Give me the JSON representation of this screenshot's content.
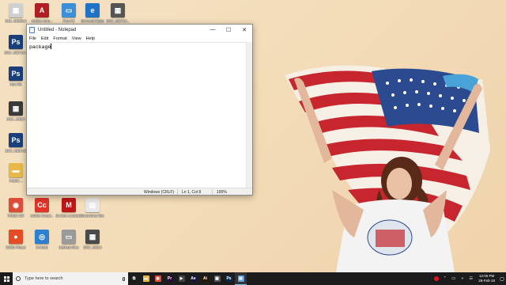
{
  "desktop": {
    "icons": [
      {
        "label": "IMG_MB8812",
        "color": "#cfcfcf",
        "glyph": "▦"
      },
      {
        "label": "Adobe Acro...",
        "color": "#b01e23",
        "glyph": "A"
      },
      {
        "label": "This PC",
        "color": "#3b8ed8",
        "glyph": "▭"
      },
      {
        "label": "Microsoft Edge",
        "color": "#1e73c9",
        "glyph": "e"
      },
      {
        "label": "DSC_MB712...",
        "color": "#555555",
        "glyph": "▦"
      },
      {
        "label": "DSC_MB712 1",
        "color": "#1a3f7a",
        "glyph": "Ps"
      },
      {
        "label": "New file",
        "color": "#1a3f7a",
        "glyph": "Ps"
      },
      {
        "label": "DSC_MB17",
        "color": "#3a3a3a",
        "glyph": "▦"
      },
      {
        "label": "DSC_MB9 (1)",
        "color": "#1a3f7a",
        "glyph": "Ps"
      },
      {
        "label": "FX600 ...",
        "color": "#e6b94a",
        "glyph": "▬"
      },
      {
        "label": "FX600 10F",
        "color": "#dd4b39",
        "glyph": "◉"
      },
      {
        "label": "Adobe Creati...",
        "color": "#e0332a",
        "glyph": "Cc"
      },
      {
        "label": "McAfee LiveSafe",
        "color": "#c01818",
        "glyph": "M"
      },
      {
        "label": "photoshop files",
        "color": "#e8e8e8",
        "glyph": "▤"
      },
      {
        "label": "iOSkit Player",
        "color": "#e34c26",
        "glyph": "●"
      },
      {
        "label": "S-Mode",
        "color": "#2c7fd1",
        "glyph": "◎"
      },
      {
        "label": "desktop files",
        "color": "#9a9a9a",
        "glyph": "▭"
      },
      {
        "label": "DSC_MB21",
        "color": "#4a4a4a",
        "glyph": "▦"
      }
    ]
  },
  "notepad": {
    "title": "Untitled - Notepad",
    "menu": [
      "File",
      "Edit",
      "Format",
      "View",
      "Help"
    ],
    "content": "package",
    "status": {
      "encoding": "Windows (CRLF)",
      "position": "Ln 1, Col 8",
      "zoom": "100%"
    },
    "controls": {
      "minimize": "—",
      "maximize": "☐",
      "close": "✕"
    }
  },
  "taskbar": {
    "search_placeholder": "Type here to search",
    "apps": [
      {
        "name": "task-view",
        "glyph": "⧉",
        "color": "#1c1c1c"
      },
      {
        "name": "file-explorer",
        "glyph": "▬",
        "color": "#e6b94a"
      },
      {
        "name": "chrome",
        "glyph": "◉",
        "color": "#dd4b39"
      },
      {
        "name": "premiere",
        "glyph": "Pr",
        "color": "#2a0a3a"
      },
      {
        "name": "video-editor",
        "glyph": "▶",
        "color": "#444444"
      },
      {
        "name": "after-effects",
        "glyph": "Ae",
        "color": "#1b1040"
      },
      {
        "name": "illustrator",
        "glyph": "Ai",
        "color": "#2d1400"
      },
      {
        "name": "photo-app",
        "glyph": "▦",
        "color": "#555555"
      },
      {
        "name": "photoshop",
        "glyph": "Ps",
        "color": "#0b2a4a"
      },
      {
        "name": "notepad",
        "glyph": "▤",
        "color": "#5c9fdc"
      }
    ],
    "tray": {
      "icons": [
        "●",
        "⌃",
        "▭",
        "◖",
        "☰"
      ],
      "record_color": "#e81123"
    },
    "clock": {
      "time": "12:05 PM",
      "date": "28-Feb-19"
    },
    "notification_glyph": "▢"
  },
  "colors": {
    "accent": "#76b9ed",
    "taskbar": "#1c1c1c"
  }
}
